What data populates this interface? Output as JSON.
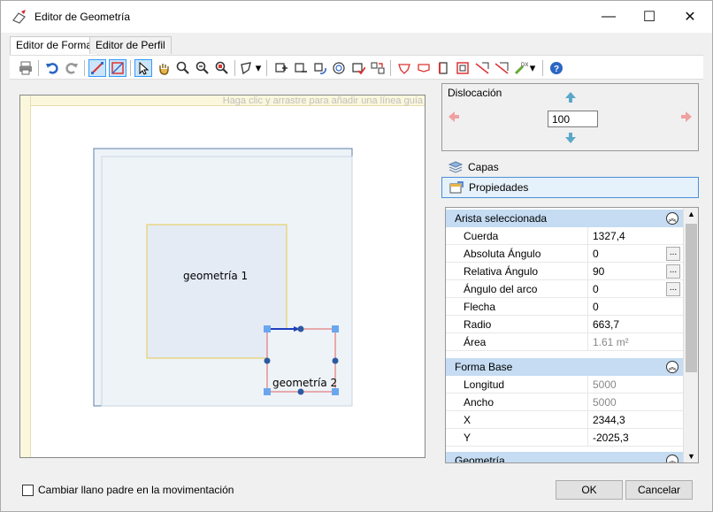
{
  "window": {
    "title": "Editor de Geometría",
    "minimize": "—",
    "maximize": "☐",
    "close": "✕"
  },
  "tabs": [
    {
      "label": "Editor de Forma",
      "active": true
    },
    {
      "label": "Editor de Perfil",
      "active": false
    }
  ],
  "canvas": {
    "guide_hint": "Haga clic y arrastre para añadir una línea guía",
    "shape1_label": "geometría 1",
    "shape2_label": "geometría 2"
  },
  "dislocacion": {
    "label": "Dislocación",
    "value": "100"
  },
  "sections": {
    "capas": "Capas",
    "propiedades": "Propiedades"
  },
  "grid": {
    "arista": {
      "title": "Arista seleccionada",
      "rows": [
        {
          "key": "Cuerda",
          "value": "1327,4",
          "gray": false,
          "ellipsis": false
        },
        {
          "key": "Absoluta Ángulo",
          "value": "0",
          "gray": false,
          "ellipsis": true
        },
        {
          "key": "Relativa Ángulo",
          "value": "90",
          "gray": false,
          "ellipsis": true
        },
        {
          "key": "Ángulo del arco",
          "value": "0",
          "gray": false,
          "ellipsis": true
        },
        {
          "key": "Flecha",
          "value": "0",
          "gray": false,
          "ellipsis": false
        },
        {
          "key": "Radio",
          "value": "663,7",
          "gray": false,
          "ellipsis": false
        },
        {
          "key": "Área",
          "value": "1.61 m²",
          "gray": true,
          "ellipsis": false
        }
      ]
    },
    "forma": {
      "title": "Forma Base",
      "rows": [
        {
          "key": "Longitud",
          "value": "5000",
          "gray": true,
          "ellipsis": false
        },
        {
          "key": "Ancho",
          "value": "5000",
          "gray": true,
          "ellipsis": false
        },
        {
          "key": "X",
          "value": "2344,3",
          "gray": false,
          "ellipsis": false
        },
        {
          "key": "Y",
          "value": "-2025,3",
          "gray": false,
          "ellipsis": false
        }
      ]
    },
    "geometria": {
      "title": "Geometría"
    }
  },
  "bottom": {
    "checkbox_label": "Cambiar llano padre en la movimentación",
    "ok": "OK",
    "cancel": "Cancelar"
  },
  "colors": {
    "accent": "#3399ff",
    "section_header": "#c5dcf2",
    "shape_yellow": "#e8c84a",
    "shape_red": "#e06060",
    "handle_blue": "#5b9bd5"
  }
}
